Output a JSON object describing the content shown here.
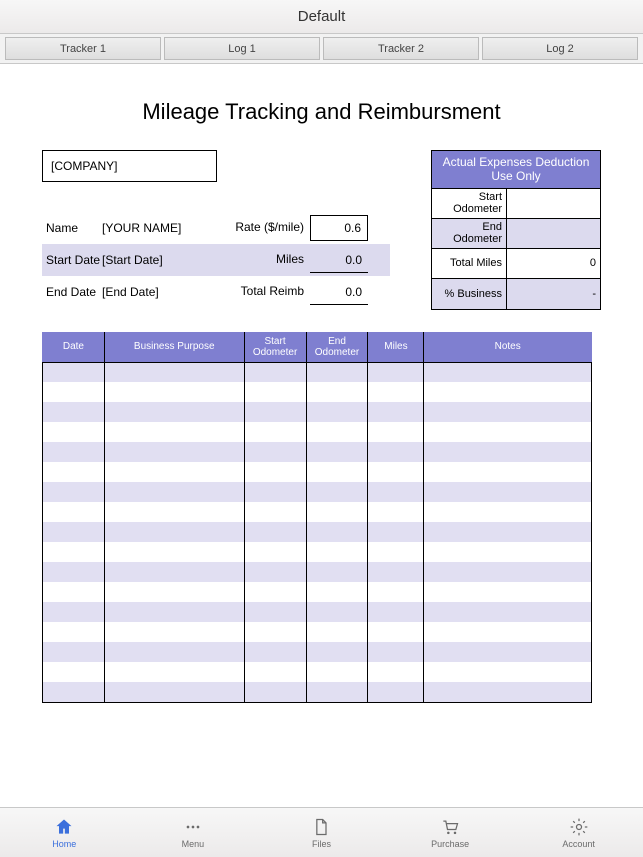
{
  "topbar": {
    "title": "Default"
  },
  "tabs": [
    "Tracker 1",
    "Log 1",
    "Tracker 2",
    "Log 2"
  ],
  "document": {
    "title": "Mileage Tracking and Reimbursment",
    "company": "[COMPANY]",
    "fields": {
      "name_label": "Name",
      "name_value": "[YOUR NAME]",
      "rate_label": "Rate ($/mile)",
      "rate_value": "0.6",
      "start_date_label": "Start Date",
      "start_date_value": "[Start Date]",
      "miles_label": "Miles",
      "miles_value": "0.0",
      "end_date_label": "End Date",
      "end_date_value": "[End Date]",
      "total_reimb_label": "Total Reimb",
      "total_reimb_value": "0.0"
    },
    "actual": {
      "header": "Actual Expenses Deduction Use Only",
      "start_odo_label": "Start Odometer",
      "start_odo_value": "",
      "end_odo_label": "End Odometer",
      "end_odo_value": "",
      "total_miles_label": "Total Miles",
      "total_miles_value": "0",
      "pct_business_label": "% Business",
      "pct_business_value": "-"
    },
    "log_headers": {
      "date": "Date",
      "purpose": "Business Purpose",
      "start_odo": "Start Odometer",
      "end_odo": "End Odometer",
      "miles": "Miles",
      "notes": "Notes"
    }
  },
  "nav": {
    "home": "Home",
    "menu": "Menu",
    "files": "Files",
    "purchase": "Purchase",
    "account": "Account"
  }
}
